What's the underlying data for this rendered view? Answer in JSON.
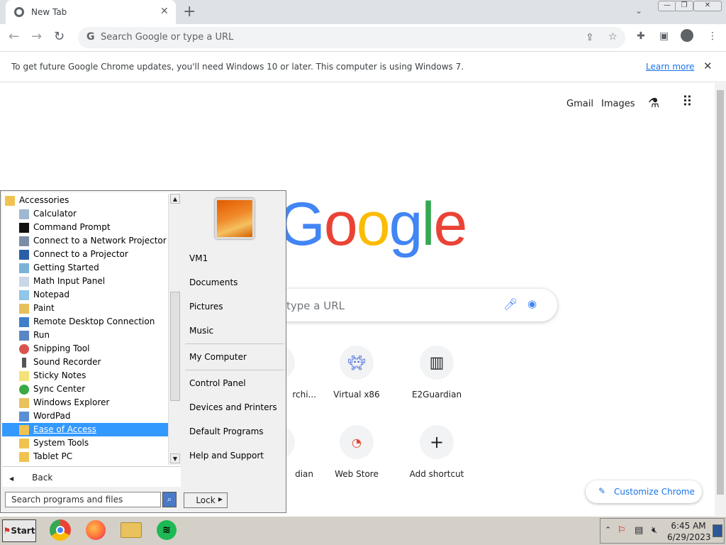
{
  "browser": {
    "tab_title": "New Tab",
    "omnibox_placeholder": "Search Google or type a URL"
  },
  "infobar": {
    "message": "To get future Google Chrome updates, you'll need Windows 10 or later. This computer is using Windows 7.",
    "learn_more": "Learn more"
  },
  "ntp": {
    "gmail": "Gmail",
    "images": "Images",
    "logo": "Google",
    "search_placeholder": "Search Google or type a URL",
    "visible_search_placeholder": "type a URL",
    "shortcuts": [
      {
        "label": "archi...",
        "visible_label": "rchi..."
      },
      {
        "label": "Virtual x86"
      },
      {
        "label": "E2Guardian"
      },
      {
        "label": "Guardian",
        "visible_label": "dian"
      },
      {
        "label": "Web Store"
      },
      {
        "label": "Add shortcut"
      }
    ],
    "customize": "Customize Chrome"
  },
  "startmenu": {
    "programs": [
      {
        "label": "Accessories",
        "type": "folder"
      },
      {
        "label": "Calculator"
      },
      {
        "label": "Command Prompt"
      },
      {
        "label": "Connect to a Network Projector"
      },
      {
        "label": "Connect to a Projector"
      },
      {
        "label": "Getting Started"
      },
      {
        "label": "Math Input Panel"
      },
      {
        "label": "Notepad"
      },
      {
        "label": "Paint"
      },
      {
        "label": "Remote Desktop Connection"
      },
      {
        "label": "Run"
      },
      {
        "label": "Snipping Tool"
      },
      {
        "label": "Sound Recorder"
      },
      {
        "label": "Sticky Notes"
      },
      {
        "label": "Sync Center"
      },
      {
        "label": "Windows Explorer"
      },
      {
        "label": "WordPad"
      },
      {
        "label": "Ease of Access",
        "type": "folder",
        "selected": true
      },
      {
        "label": "System Tools",
        "type": "folder"
      },
      {
        "label": "Tablet PC",
        "type": "folder"
      }
    ],
    "back": "Back",
    "search_placeholder": "Search programs and files",
    "right_items": [
      "VM1",
      "Documents",
      "Pictures",
      "Music",
      "My Computer",
      "Control Panel",
      "Devices and Printers",
      "Default Programs",
      "Help and Support"
    ],
    "lock": "Lock"
  },
  "taskbar": {
    "start": "Start",
    "time": "6:45 AM",
    "date": "6/29/2023"
  },
  "colors": {
    "selection": "#3399ff",
    "google_blue": "#4285f4",
    "google_red": "#ea4335",
    "google_yellow": "#fbbc05",
    "google_green": "#34a853",
    "chrome_accent": "#1a73e8"
  }
}
